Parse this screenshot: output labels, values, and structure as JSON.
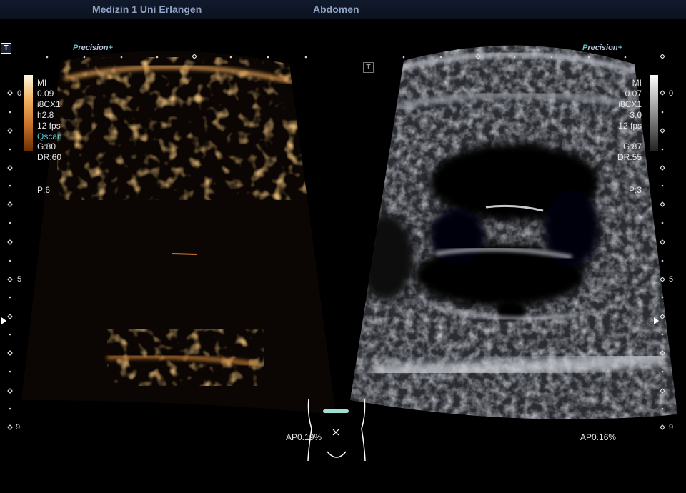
{
  "header": {
    "institution": "Medizin 1 Uni Erlangen",
    "exam": "Abdomen"
  },
  "left_panel": {
    "brand_prefix": "P",
    "brand_rest": "recision",
    "brand_suffix": "+",
    "mi_label": "MI",
    "mi_value": "0.09",
    "transducer": "i8CX1",
    "frequency": "h2.8",
    "frame_rate": "12 fps",
    "mode": "Qscan",
    "gain": "G:80",
    "dynamic_range": "DR:60",
    "persistence": "P:6",
    "acoustic_power": "AP0.19%",
    "colormap": "orange",
    "colorbar_top": "#fff7e0",
    "colorbar_bottom": "#6b2f00"
  },
  "right_panel": {
    "brand_prefix": "P",
    "brand_rest": "recision",
    "brand_suffix": "+",
    "mi_label": "MI",
    "mi_value": "0.07",
    "transducer": "i8CX1",
    "frequency": "3.0",
    "frame_rate": "12 fps",
    "gain": "G:87",
    "dynamic_range": "DR:55",
    "persistence": "P:3",
    "acoustic_power": "AP0.16%",
    "colormap": "grayscale",
    "colorbar_top": "#ffffff",
    "colorbar_bottom": "#222222"
  },
  "depth_scale": {
    "top": "0",
    "mid": "5",
    "bottom": "9"
  },
  "icons": {
    "left_mark": "T",
    "right_mark": "T",
    "body_marker": "torso-body-marker-icon",
    "focus": "focus-triangle-icon"
  },
  "colors": {
    "accent_teal": "#5ec5c8",
    "header_text": "#8fa3c4",
    "contrast_orange": "#e0a060"
  }
}
